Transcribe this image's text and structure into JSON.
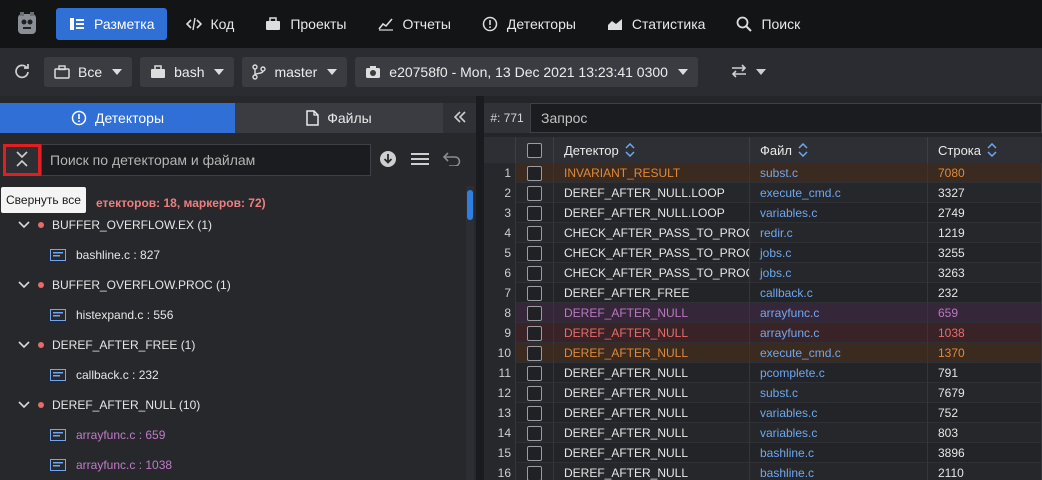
{
  "nav": {
    "items": [
      {
        "label": "Разметка",
        "icon": "list-icon",
        "active": true
      },
      {
        "label": "Код",
        "icon": "code-icon",
        "active": false
      },
      {
        "label": "Проекты",
        "icon": "briefcase-icon",
        "active": false
      },
      {
        "label": "Отчеты",
        "icon": "chart-icon",
        "active": false
      },
      {
        "label": "Детекторы",
        "icon": "alert-icon",
        "active": false
      },
      {
        "label": "Статистика",
        "icon": "area-chart-icon",
        "active": false
      },
      {
        "label": "Поиск",
        "icon": "search-icon",
        "active": false
      }
    ]
  },
  "toolbar": {
    "scope": "Все",
    "project": "bash",
    "branch": "master",
    "snapshot": "e20758f0 - Mon, 13 Dec 2021 13:23:41 0300"
  },
  "left": {
    "tab_detectors": "Детекторы",
    "tab_files": "Файлы",
    "search_placeholder": "Поиск по детекторам и файлам",
    "tooltip": "Свернуть все",
    "summary": "етекторов: 18, маркеров: 72)",
    "tree": [
      {
        "type": "group",
        "label": "BUFFER_OVERFLOW.EX (1)"
      },
      {
        "type": "file",
        "label": "bashline.c : 827",
        "pink": false
      },
      {
        "type": "group",
        "label": "BUFFER_OVERFLOW.PROC (1)"
      },
      {
        "type": "file",
        "label": "histexpand.c : 556",
        "pink": false
      },
      {
        "type": "group",
        "label": "DEREF_AFTER_FREE (1)"
      },
      {
        "type": "file",
        "label": "callback.c : 232",
        "pink": false
      },
      {
        "type": "group",
        "label": "DEREF_AFTER_NULL (10)"
      },
      {
        "type": "file",
        "label": "arrayfunc.c : 659",
        "pink": true
      },
      {
        "type": "file",
        "label": "arrayfunc.c : 1038",
        "pink": true
      }
    ]
  },
  "right": {
    "query_count": "#: 771",
    "query_placeholder": "Запрос",
    "columns": {
      "detector": "Детектор",
      "file": "Файл",
      "line": "Строка"
    },
    "rows": [
      {
        "n": "1",
        "detector": "INVARIANT_RESULT",
        "file": "subst.c",
        "line": "7080",
        "style": "orange"
      },
      {
        "n": "2",
        "detector": "DEREF_AFTER_NULL.LOOP",
        "file": "execute_cmd.c",
        "line": "3327",
        "style": "normal"
      },
      {
        "n": "3",
        "detector": "DEREF_AFTER_NULL.LOOP",
        "file": "variables.c",
        "line": "2749",
        "style": "normal"
      },
      {
        "n": "4",
        "detector": "CHECK_AFTER_PASS_TO_PROC",
        "file": "redir.c",
        "line": "1219",
        "style": "normal"
      },
      {
        "n": "5",
        "detector": "CHECK_AFTER_PASS_TO_PROC",
        "file": "jobs.c",
        "line": "3255",
        "style": "normal"
      },
      {
        "n": "6",
        "detector": "CHECK_AFTER_PASS_TO_PROC",
        "file": "jobs.c",
        "line": "3263",
        "style": "normal"
      },
      {
        "n": "7",
        "detector": "DEREF_AFTER_FREE",
        "file": "callback.c",
        "line": "232",
        "style": "normal"
      },
      {
        "n": "8",
        "detector": "DEREF_AFTER_NULL",
        "file": "arrayfunc.c",
        "line": "659",
        "style": "purple"
      },
      {
        "n": "9",
        "detector": "DEREF_AFTER_NULL",
        "file": "arrayfunc.c",
        "line": "1038",
        "style": "red"
      },
      {
        "n": "10",
        "detector": "DEREF_AFTER_NULL",
        "file": "execute_cmd.c",
        "line": "1370",
        "style": "orange"
      },
      {
        "n": "11",
        "detector": "DEREF_AFTER_NULL",
        "file": "pcomplete.c",
        "line": "791",
        "style": "normal"
      },
      {
        "n": "12",
        "detector": "DEREF_AFTER_NULL",
        "file": "subst.c",
        "line": "7679",
        "style": "normal"
      },
      {
        "n": "13",
        "detector": "DEREF_AFTER_NULL",
        "file": "variables.c",
        "line": "752",
        "style": "normal"
      },
      {
        "n": "14",
        "detector": "DEREF_AFTER_NULL",
        "file": "variables.c",
        "line": "803",
        "style": "normal"
      },
      {
        "n": "15",
        "detector": "DEREF_AFTER_NULL",
        "file": "bashline.c",
        "line": "3896",
        "style": "normal"
      },
      {
        "n": "16",
        "detector": "DEREF_AFTER_NULL",
        "file": "bashline.c",
        "line": "2110",
        "style": "normal"
      }
    ]
  }
}
